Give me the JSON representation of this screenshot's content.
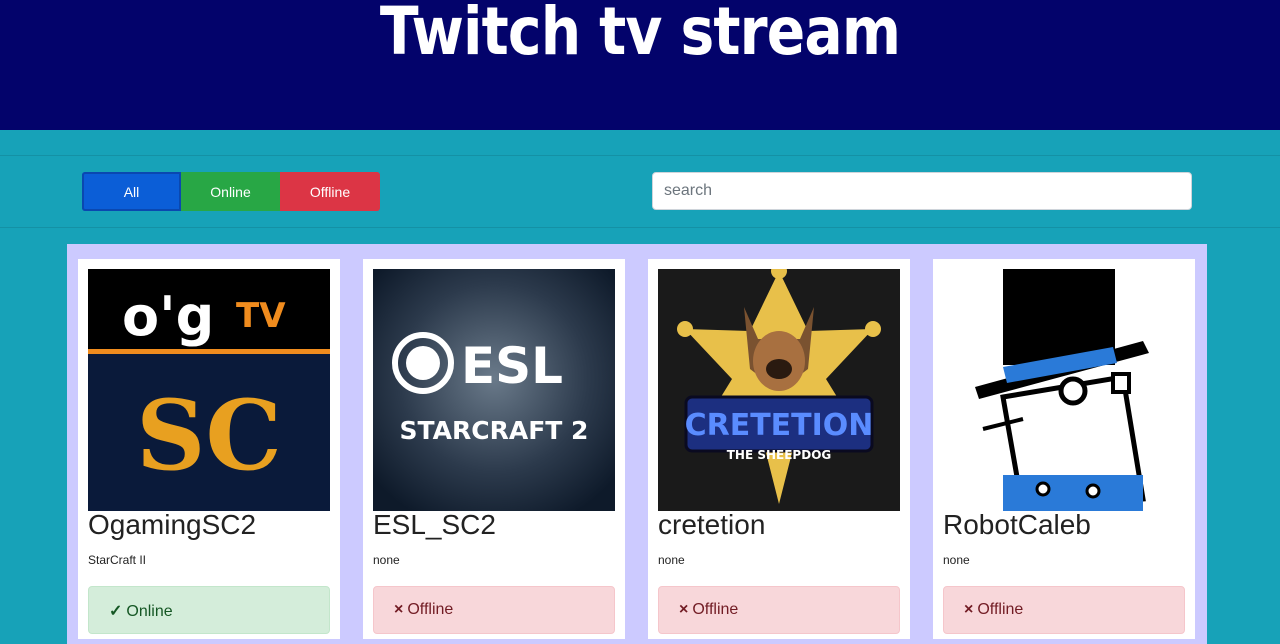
{
  "header": {
    "title": "Twitch tv stream"
  },
  "filters": {
    "all": "All",
    "online": "Online",
    "offline": "Offline"
  },
  "search": {
    "placeholder": "search",
    "value": ""
  },
  "colors": {
    "header_bg": "#03036b",
    "page_bg": "#17a2b8",
    "panel_bg": "#cccaff",
    "all": "#0b5ed7",
    "online": "#28a745",
    "offline": "#dc3545"
  },
  "channels": [
    {
      "name": "OgamingSC2",
      "game": "StarCraft II",
      "status_mark": "✓",
      "status": "Online",
      "logo_text_top": "o'g",
      "logo_text_tv": "TV",
      "logo_text_sc": "SC"
    },
    {
      "name": "ESL_SC2",
      "game": "none",
      "status_mark": "×",
      "status": "Offline",
      "logo_text_top": "ESL",
      "logo_text_bottom": "STARCRAFT 2"
    },
    {
      "name": "cretetion",
      "game": "none",
      "status_mark": "×",
      "status": "Offline",
      "logo_text_top": "CRETETION",
      "logo_text_bottom": "THE SHEEPDOG"
    },
    {
      "name": "RobotCaleb",
      "game": "none",
      "status_mark": "×",
      "status": "Offline"
    }
  ]
}
